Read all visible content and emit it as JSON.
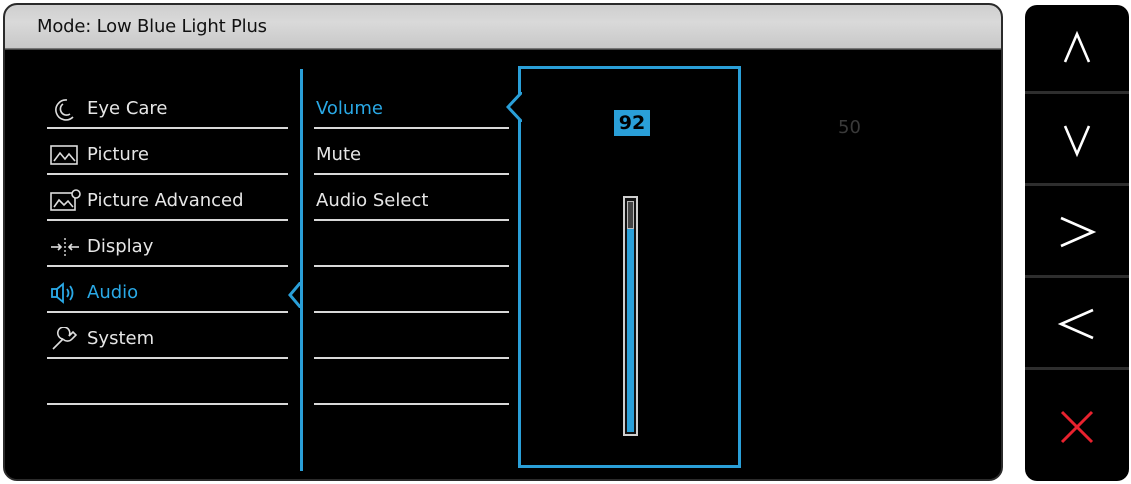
{
  "osd": {
    "title": "Mode: Low Blue Light Plus"
  },
  "menu": {
    "items": [
      {
        "label": "Eye Care",
        "icon": "eye-care-icon",
        "active": false
      },
      {
        "label": "Picture",
        "icon": "picture-icon",
        "active": false
      },
      {
        "label": "Picture Advanced",
        "icon": "picture-advanced-icon",
        "active": false
      },
      {
        "label": "Display",
        "icon": "display-icon",
        "active": false
      },
      {
        "label": "Audio",
        "icon": "audio-icon",
        "active": true
      },
      {
        "label": "System",
        "icon": "system-icon",
        "active": false
      }
    ]
  },
  "submenu": {
    "items": [
      {
        "label": "Volume",
        "active": true
      },
      {
        "label": "Mute",
        "active": false
      },
      {
        "label": "Audio Select",
        "active": false
      }
    ]
  },
  "volume": {
    "value": "92",
    "level": 0.92,
    "reference_value": "50"
  },
  "keys": [
    {
      "name": "up-key",
      "icon": "caret-up-icon"
    },
    {
      "name": "down-key",
      "icon": "caret-down-icon"
    },
    {
      "name": "right-key",
      "icon": "caret-right-icon"
    },
    {
      "name": "left-key",
      "icon": "caret-left-icon"
    },
    {
      "name": "close-key",
      "icon": "close-icon"
    }
  ],
  "colors": {
    "accent": "#2aa9e6",
    "close": "#e8222e"
  }
}
